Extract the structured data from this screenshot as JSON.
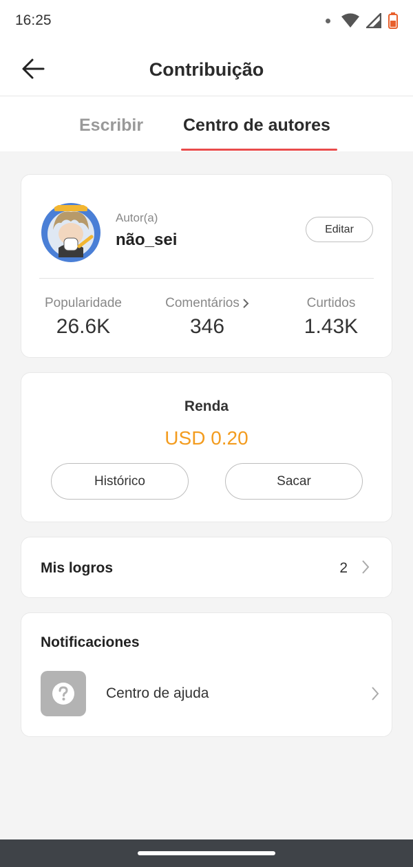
{
  "status_bar": {
    "time": "16:25",
    "icons": [
      "notification-dot",
      "wifi-icon",
      "signal-icon",
      "battery-icon"
    ]
  },
  "app_bar": {
    "title": "Contribuição",
    "back_icon": "arrow-left-icon"
  },
  "tabs": [
    {
      "label": "Escribir",
      "active": false
    },
    {
      "label": "Centro de autores",
      "active": true
    }
  ],
  "profile": {
    "role": "Autor(a)",
    "username": "não_sei",
    "edit_label": "Editar",
    "stats": [
      {
        "label": "Popularidade",
        "value": "26.6K"
      },
      {
        "label": "Comentários",
        "value": "346"
      },
      {
        "label": "Curtidos",
        "value": "1.43K"
      }
    ]
  },
  "income": {
    "title": "Renda",
    "amount": "USD 0.20",
    "history_label": "Histórico",
    "withdraw_label": "Sacar"
  },
  "achievements": {
    "label": "Mis logros",
    "count": "2"
  },
  "notifications": {
    "title": "Notificaciones",
    "help_label": "Centro de ajuda"
  },
  "colors": {
    "accent": "#e94b4b",
    "income": "#f39c1f",
    "nav_bar": "#3f4348"
  }
}
